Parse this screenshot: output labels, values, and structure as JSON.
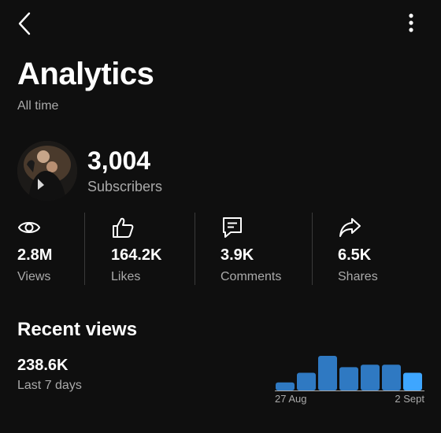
{
  "header": {
    "title": "Analytics",
    "subtitle": "All time"
  },
  "channel": {
    "subscriber_count": "3,004",
    "subscriber_label": "Subscribers"
  },
  "stats": [
    {
      "value": "2.8M",
      "label": "Views",
      "icon": "eye-icon"
    },
    {
      "value": "164.2K",
      "label": "Likes",
      "icon": "thumbs-up-icon"
    },
    {
      "value": "3.9K",
      "label": "Comments",
      "icon": "comment-icon"
    },
    {
      "value": "6.5K",
      "label": "Shares",
      "icon": "share-icon"
    }
  ],
  "recent": {
    "title": "Recent views",
    "value": "238.6K",
    "period": "Last 7 days"
  },
  "chart_data": {
    "type": "bar",
    "x_tick_labels": [
      "27 Aug",
      "2 Sept"
    ],
    "values": [
      10,
      22,
      43,
      29,
      32,
      32,
      22
    ],
    "bar_color": "#2f79c2",
    "highlight_color": "#3ea6ff",
    "highlight_index": 6,
    "baseline_color": "#aaaaaa"
  },
  "colors": {
    "background": "#0f0f0f",
    "text_primary": "#ffffff",
    "text_secondary": "#aaaaaa"
  }
}
